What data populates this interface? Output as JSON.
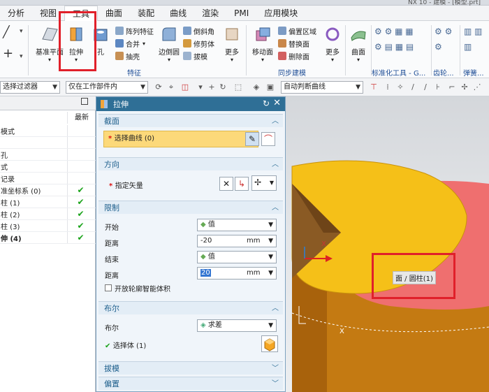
{
  "window": {
    "title": "NX 10 - 建模 - [模型.prt]"
  },
  "menu": {
    "items": [
      "分析",
      "视图",
      "工具",
      "曲面",
      "装配",
      "曲线",
      "渲染",
      "PMI",
      "应用模块"
    ]
  },
  "ribbon": {
    "datum_plane": "基准平面",
    "extrude": "拉伸",
    "hole": "孔",
    "pattern_feature": "阵列特征",
    "unite": "合并",
    "shell": "抽壳",
    "edge_blend": "边倒圆",
    "chamfer": "倒斜角",
    "trim_body": "修剪体",
    "draft": "拔模",
    "more": "更多",
    "move_face": "移动面",
    "offset_region": "偏置区域",
    "replace_face": "替换面",
    "delete_face": "删除面",
    "surface": "曲面",
    "group_feature": "特征",
    "group_sync": "同步建模",
    "group_std_tools": "标准化工具 - G...",
    "group_gear": "齿轮...",
    "group_spring": "弹簧..."
  },
  "toolbar2": {
    "filter": "选择过滤器",
    "scope": "仅在工作部件内",
    "curve_rule": "自动判断曲线"
  },
  "navigator": {
    "col_latest": "最新",
    "rows": [
      {
        "name": "模式",
        "check": false,
        "bold": false
      },
      {
        "name": "",
        "check": false,
        "bold": false
      },
      {
        "name": "孔",
        "check": false,
        "bold": false
      },
      {
        "name": "式",
        "check": false,
        "bold": false
      },
      {
        "name": "记录",
        "check": false,
        "bold": false
      },
      {
        "name": "准坐标系 (0)",
        "check": true,
        "bold": false
      },
      {
        "name": "柱 (1)",
        "check": true,
        "bold": false
      },
      {
        "name": "柱 (2)",
        "check": true,
        "bold": false
      },
      {
        "name": "柱 (3)",
        "check": true,
        "bold": false
      },
      {
        "name": "伸 (4)",
        "check": true,
        "bold": true
      }
    ],
    "check_mark": "✔"
  },
  "dialog": {
    "title": "拉伸",
    "section_label": "截面",
    "select_curve": "选择曲线 (0)",
    "direction_label": "方向",
    "specify_vector": "指定矢量",
    "limits_label": "限制",
    "start_label": "开始",
    "start_value": "值",
    "distance_label": "距离",
    "start_distance": "-20",
    "end_label": "结束",
    "end_value": "值",
    "end_distance": "20",
    "unit": "mm",
    "open_profile": "开放轮廓智能体积",
    "boolean_section": "布尔",
    "boolean_label": "布尔",
    "boolean_value": "求差",
    "select_body": "选择体 (1)",
    "draft_section": "拔模",
    "offset_section": "偏置"
  },
  "viewport": {
    "face_tag": "面 / 圆柱(1)",
    "axis_x": "X"
  },
  "colors": {
    "highlight_red": "#e0202a",
    "dialog_blue": "#2f6f96",
    "body_yellow": "#f5c018",
    "body_orange": "#c47a12",
    "face_pink": "#ef6f6f"
  }
}
